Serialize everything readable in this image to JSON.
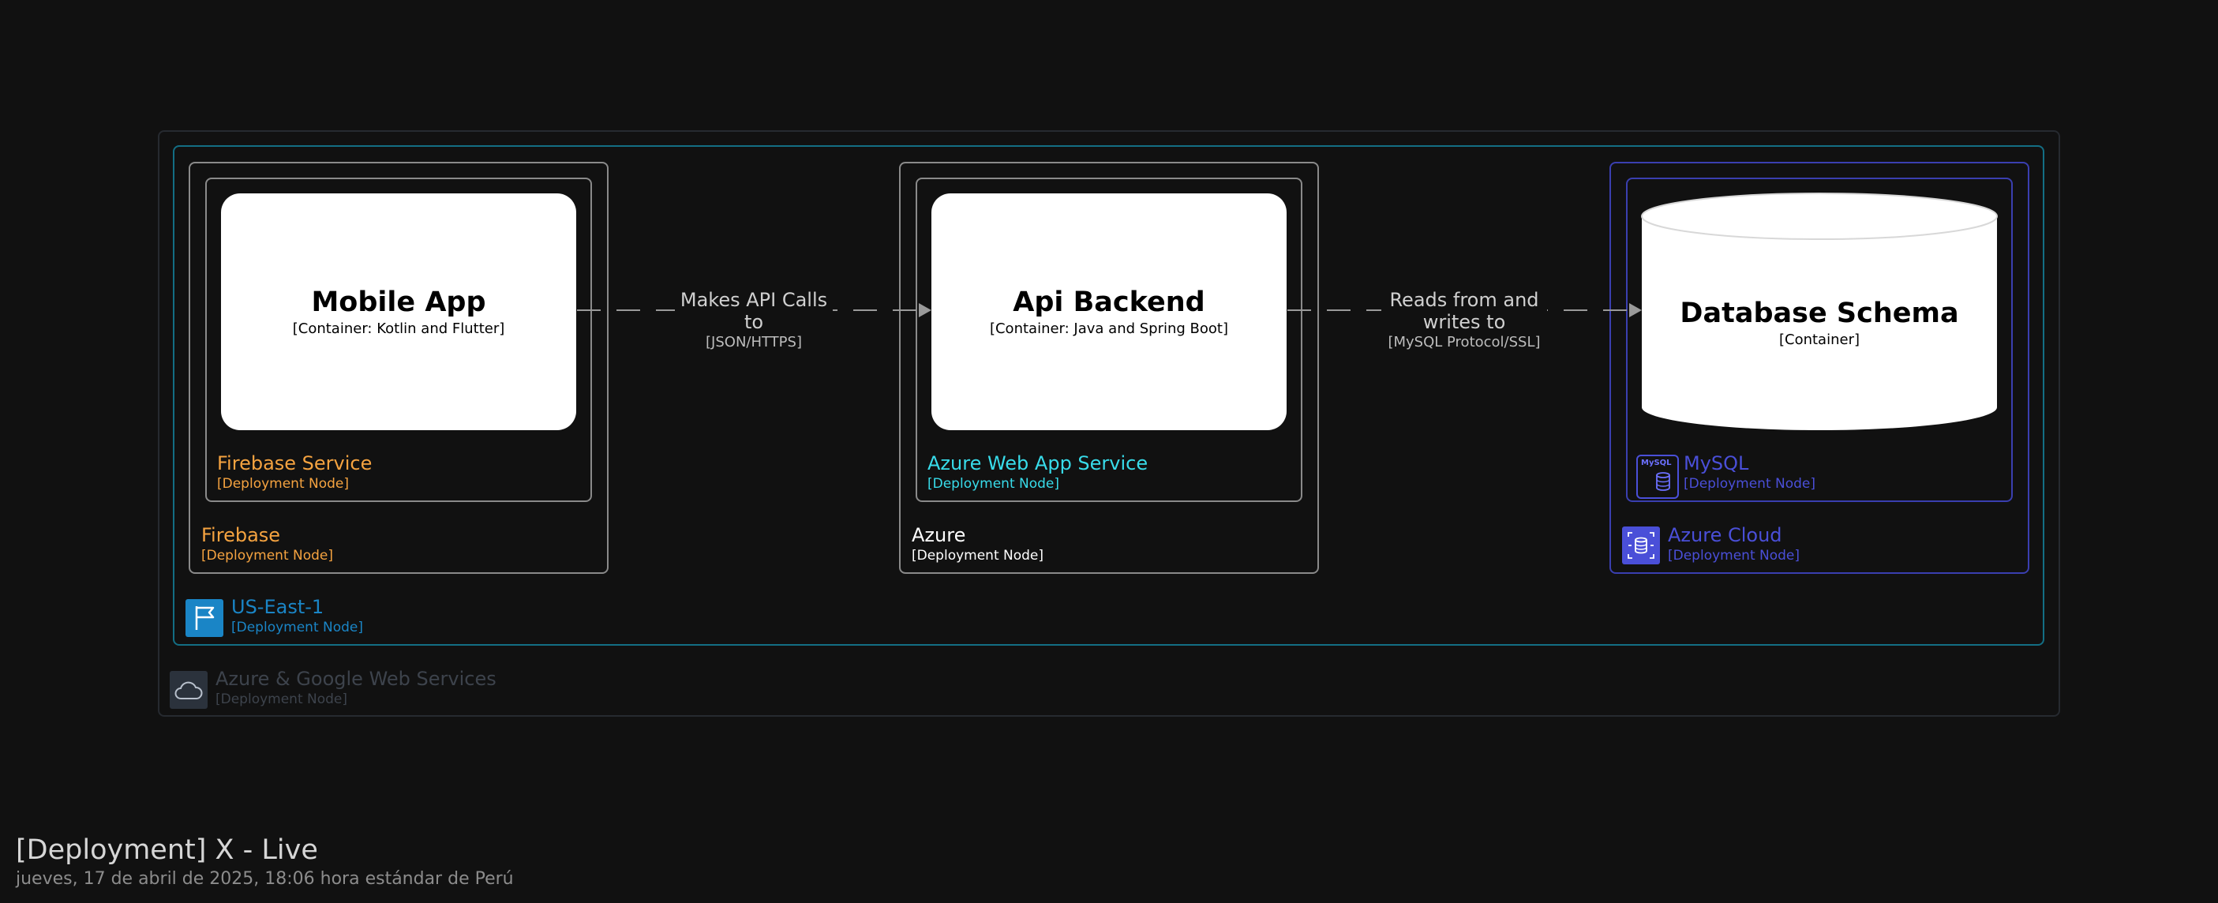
{
  "nodes": {
    "cloud": {
      "title": "Azure & Google Web Services",
      "subtitle": "[Deployment Node]",
      "icon": "cloud-icon",
      "color": "#444a55"
    },
    "region": {
      "title": "US-East-1",
      "subtitle": "[Deployment Node]",
      "icon": "flag-icon",
      "color": "#1a85c6"
    },
    "firebase": {
      "title": "Firebase",
      "subtitle": "[Deployment Node]",
      "color": "#f5a340"
    },
    "firebase_service": {
      "title": "Firebase Service",
      "subtitle": "[Deployment Node]",
      "color": "#f5a340"
    },
    "azure": {
      "title": "Azure",
      "subtitle": "[Deployment Node]",
      "color": "#ffffff"
    },
    "azure_webapp": {
      "title": "Azure Web App Service",
      "subtitle": "[Deployment Node]",
      "color": "#38dcea"
    },
    "azure_cloud": {
      "title": "Azure Cloud",
      "subtitle": "[Deployment Node]",
      "icon": "azure-database-icon",
      "color": "#4a4fd8"
    },
    "mysql": {
      "title": "MySQL",
      "subtitle": "[Deployment Node]",
      "icon": "mysql-icon",
      "icon_text": "MySQL",
      "color": "#4a4fd8"
    }
  },
  "containers": {
    "mobile_app": {
      "name": "Mobile App",
      "tech": "[Container: Kotlin and Flutter]"
    },
    "api_backend": {
      "name": "Api Backend",
      "tech": "[Container: Java and Spring Boot]"
    },
    "database": {
      "name": "Database Schema",
      "tech": "[Container]"
    }
  },
  "relations": {
    "app_to_api": {
      "description_line1": "Makes API Calls",
      "description_line2": "to",
      "protocol": "[JSON/HTTPS]"
    },
    "api_to_db": {
      "description_line1": "Reads from and",
      "description_line2": "writes to",
      "protocol": "[MySQL Protocol/SSL]"
    }
  },
  "footer": {
    "title": "[Deployment] X - Live",
    "date": "jueves, 17 de abril de 2025, 18:06 hora estándar de Perú"
  }
}
